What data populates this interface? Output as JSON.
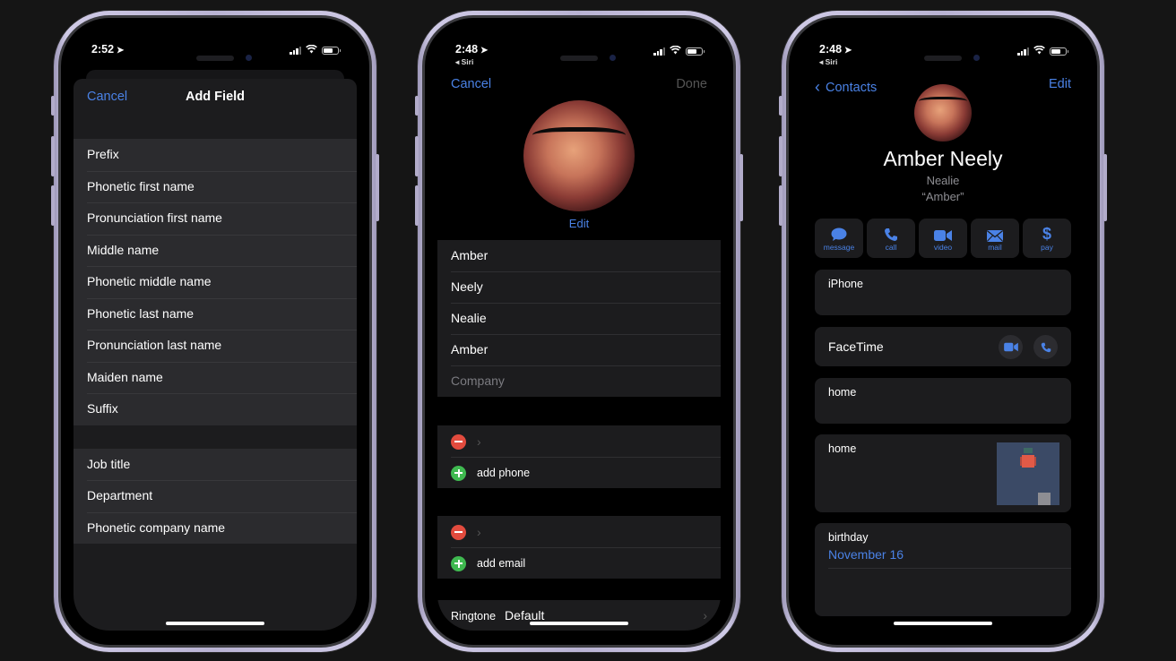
{
  "phones": [
    {
      "status": {
        "time": "2:52",
        "location_icon": "location-arrow-icon"
      },
      "nav": {
        "cancel": "Cancel",
        "title": "Add Field"
      },
      "name_fields": [
        "Prefix",
        "Phonetic first name",
        "Pronunciation first name",
        "Middle name",
        "Phonetic middle name",
        "Phonetic last name",
        "Pronunciation last name",
        "Maiden name",
        "Suffix"
      ],
      "work_fields": [
        "Job title",
        "Department",
        "Phonetic company name"
      ]
    },
    {
      "status": {
        "time": "2:48",
        "back_app": "◂ Siri"
      },
      "nav": {
        "cancel": "Cancel",
        "done": "Done"
      },
      "edit_photo": "Edit",
      "fields": [
        {
          "value": "Amber"
        },
        {
          "value": "Neely"
        },
        {
          "value": "Nealie"
        },
        {
          "value": "Amber"
        },
        {
          "placeholder": "Company"
        }
      ],
      "phone_section": {
        "add_label": "add phone"
      },
      "email_section": {
        "add_label": "add email"
      },
      "ringtone": {
        "label": "Ringtone",
        "value": "Default"
      }
    },
    {
      "status": {
        "time": "2:48",
        "back_app": "◂ Siri"
      },
      "nav": {
        "back": "Contacts",
        "edit": "Edit"
      },
      "contact": {
        "name": "Amber Neely",
        "phonetic": "Nealie",
        "nickname": "“Amber”"
      },
      "actions": [
        {
          "label": "message",
          "icon": "message-bubble-icon"
        },
        {
          "label": "call",
          "icon": "phone-icon"
        },
        {
          "label": "video",
          "icon": "video-camera-icon"
        },
        {
          "label": "mail",
          "icon": "envelope-icon"
        },
        {
          "label": "pay",
          "icon": "dollar-icon"
        }
      ],
      "iphone_label": "iPhone",
      "facetime_label": "FaceTime",
      "home_email_label": "home",
      "home_address_label": "home",
      "birthday": {
        "label": "birthday",
        "value": "November 16"
      }
    }
  ],
  "colors": {
    "accent_blue": "#4a82e6",
    "delete_red": "#e24b3e",
    "add_green": "#3fb950",
    "cell_bg": "#1c1c1e"
  }
}
